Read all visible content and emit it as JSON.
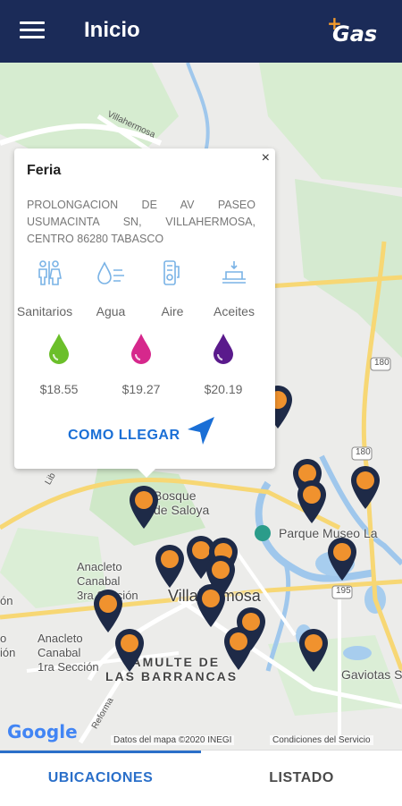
{
  "header": {
    "title": "Inicio",
    "logo_plus": "+",
    "logo_text": "Gas"
  },
  "map": {
    "labels": {
      "villahermosa_road": "Villahermosa",
      "bosque_de_saloya": "Bosque\nde Saloya",
      "parque_museo": "Parque Museo La",
      "anacleto_3ra": "Anacleto\nCanabal\n3ra Sección",
      "anacleto_1ra": "Anacleto\nCanabal\n1ra Sección",
      "villahermosa": "Villahermosa",
      "tamulte": "TAMULTE DE\nLAS BARRANCAS",
      "gaviotas": "Gaviotas Su",
      "reforma": "Reforma",
      "libramiento": "Lib",
      "edge_1": "ón",
      "edge_2": "o\nión"
    },
    "shields": [
      "180",
      "180",
      "195"
    ],
    "google_logo": "Google",
    "attribution": "Datos del mapa ©2020 INEGI",
    "terms": "Condiciones del Servicio",
    "pin_color": "#f0922e",
    "pin_body": "#1e2a47"
  },
  "station_card": {
    "name": "Feria",
    "address": "PROLONGACION DE AV PASEO USUMACINTA SN, VILLAHERMOSA, CENTRO 86280 TABASCO",
    "close_symbol": "×",
    "services": [
      {
        "icon": "restroom-icon",
        "label": "Sanitarios"
      },
      {
        "icon": "water-icon",
        "label": "Agua"
      },
      {
        "icon": "air-icon",
        "label": "Aire"
      },
      {
        "icon": "oil-icon",
        "label": "Aceites"
      }
    ],
    "fuels": [
      {
        "icon": "fuel-drop-green-icon",
        "color": "#6bbf2a",
        "price": "$18.55"
      },
      {
        "icon": "fuel-drop-magenta-icon",
        "color": "#d6288c",
        "price": "$19.27"
      },
      {
        "icon": "fuel-drop-purple-icon",
        "color": "#5a1a8c",
        "price": "$20.19"
      }
    ],
    "directions_label": "COMO LLEGAR"
  },
  "tabs": [
    {
      "label": "UBICACIONES",
      "active": true
    },
    {
      "label": "LISTADO",
      "active": false
    }
  ]
}
